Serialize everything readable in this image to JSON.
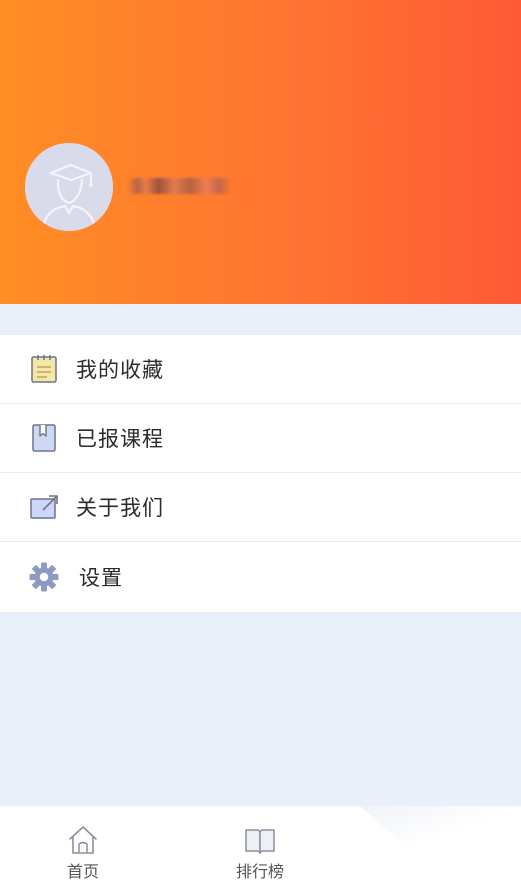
{
  "profile": {
    "username": "",
    "avatar_icon": "user-avatar-icon"
  },
  "colors": {
    "header_gradient_start": "#ff8d24",
    "header_gradient_end": "#ff5a36",
    "background": "#eaf0fa",
    "icon_accent": "#8c9ac4"
  },
  "menu": {
    "items": [
      {
        "label": "我的收藏",
        "icon": "notepad-icon"
      },
      {
        "label": "已报课程",
        "icon": "bookmark-book-icon"
      },
      {
        "label": "关于我们",
        "icon": "external-link-icon"
      },
      {
        "label": "设置",
        "icon": "gear-icon"
      }
    ]
  },
  "tabbar": {
    "tabs": [
      {
        "label": "首页",
        "icon": "home-icon"
      },
      {
        "label": "排行榜",
        "icon": "open-book-icon"
      }
    ]
  }
}
